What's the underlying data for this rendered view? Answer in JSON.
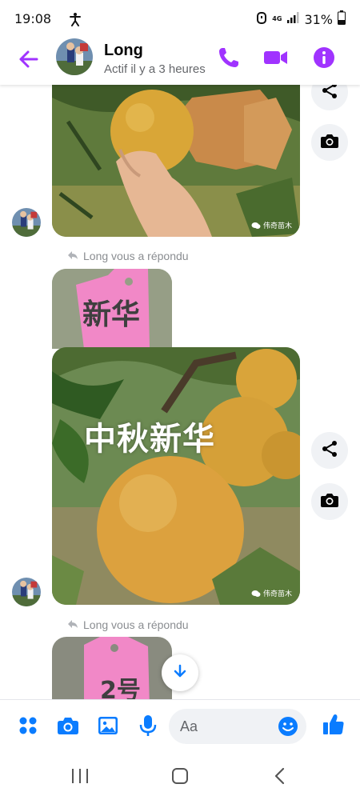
{
  "status_bar": {
    "time": "19:08",
    "network_label": "4G",
    "battery_percent": "31%",
    "icons": [
      "accessibility-icon",
      "alarm-icon",
      "signal-icon",
      "battery-icon"
    ]
  },
  "header": {
    "contact_name": "Long",
    "contact_status": "Actif il y a 3 heures",
    "icons": [
      "back-arrow-icon",
      "phone-icon",
      "video-camera-icon",
      "info-icon"
    ]
  },
  "messages": [
    {
      "type": "photo",
      "description_icon": "pear-photo",
      "watermark": "伟奇苗木"
    },
    {
      "type": "reply_label",
      "text": "Long vous a répondu"
    },
    {
      "type": "photo_with_caption",
      "overlay_text": "中秋新华",
      "tag_text": "新华",
      "watermark": "伟奇苗木"
    },
    {
      "type": "reply_label",
      "text": "Long vous a répondu"
    },
    {
      "type": "photo",
      "tag_text": "2号"
    }
  ],
  "composer": {
    "placeholder": "Aa",
    "icons": [
      "apps-grid-icon",
      "camera-icon",
      "gallery-icon",
      "microphone-icon",
      "emoji-icon",
      "thumbs-up-icon"
    ]
  },
  "colors": {
    "accent_purple": "#a033ff",
    "accent_blue": "#0a7cff",
    "reply_gray": "#8a8d91"
  }
}
